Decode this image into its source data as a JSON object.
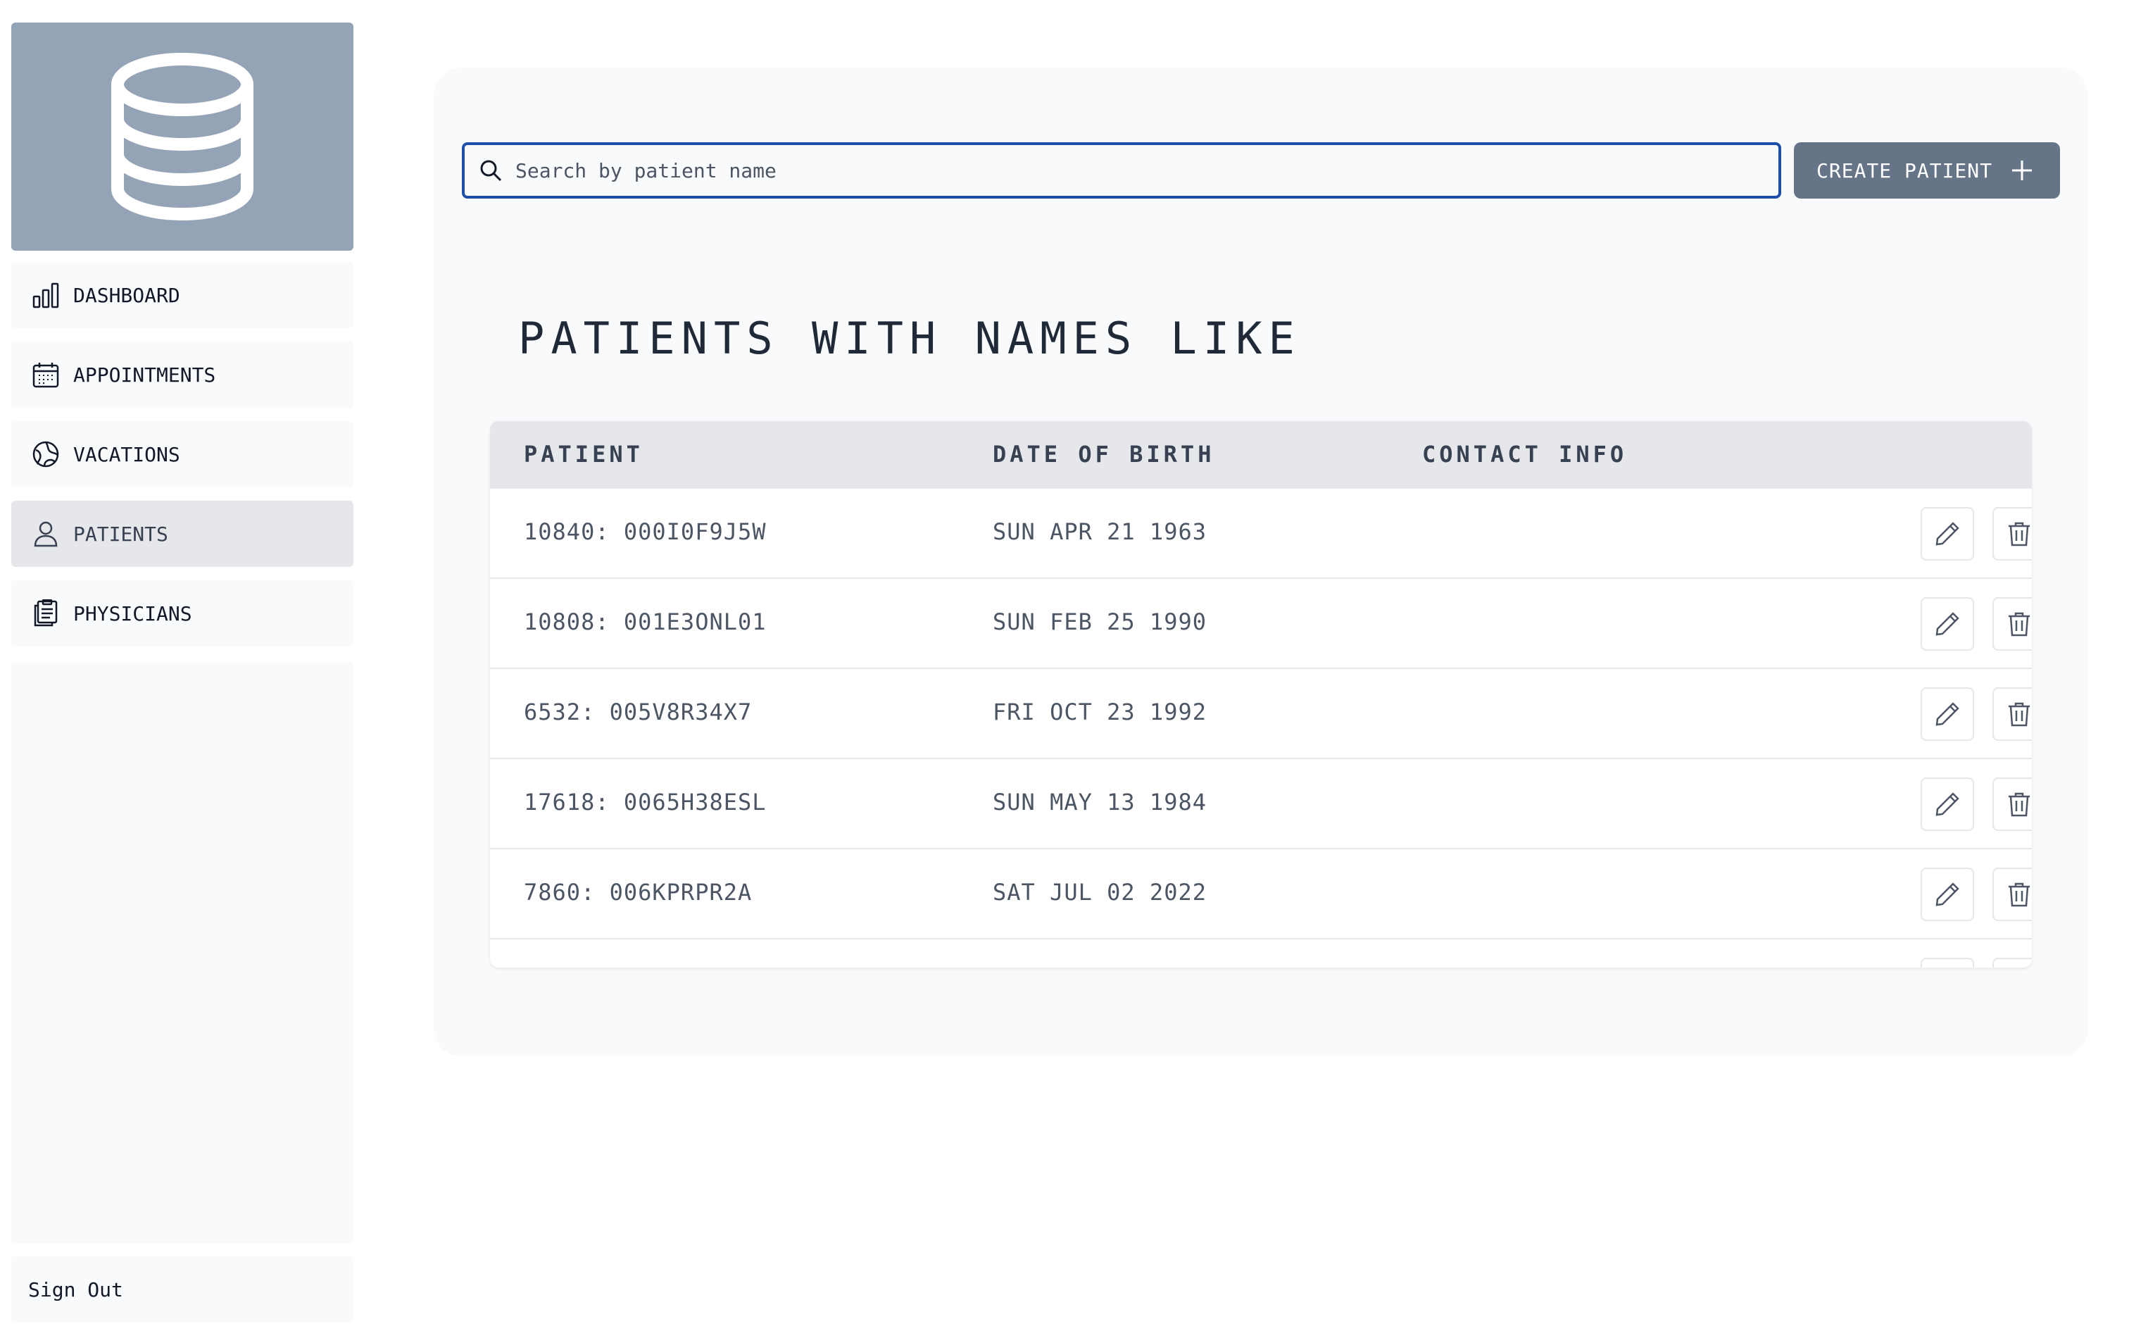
{
  "sidebar": {
    "logo_icon": "database-icon",
    "items": [
      {
        "label": "DASHBOARD",
        "icon": "bar-chart-icon"
      },
      {
        "label": "APPOINTMENTS",
        "icon": "calendar-icon"
      },
      {
        "label": "VACATIONS",
        "icon": "globe-icon"
      },
      {
        "label": "PATIENTS",
        "icon": "user-icon",
        "active": true
      },
      {
        "label": "PHYSICIANS",
        "icon": "clipboard-icon"
      }
    ],
    "sign_out": "Sign Out"
  },
  "search": {
    "placeholder": "Search by patient name",
    "value": "",
    "icon": "search-icon"
  },
  "create_button": {
    "label": "CREATE PATIENT",
    "icon": "plus-icon"
  },
  "heading": "PATIENTS WITH NAMES LIKE",
  "table": {
    "columns": [
      "PATIENT",
      "DATE OF BIRTH",
      "CONTACT INFO"
    ],
    "rows": [
      {
        "patient": "10840: 000I0F9J5W",
        "dob": "SUN APR 21 1963",
        "contact": ""
      },
      {
        "patient": "10808: 001E3ONL01",
        "dob": "SUN FEB 25 1990",
        "contact": ""
      },
      {
        "patient": "6532: 005V8R34X7",
        "dob": "FRI OCT 23 1992",
        "contact": ""
      },
      {
        "patient": "17618: 0065H38ESL",
        "dob": "SUN MAY 13 1984",
        "contact": ""
      },
      {
        "patient": "7860: 006KPRPR2A",
        "dob": "SAT JUL 02 2022",
        "contact": ""
      }
    ],
    "row_actions": [
      "pencil-icon",
      "trash-icon"
    ]
  },
  "colors": {
    "logo_bg": "#95a3b7",
    "accent_button": "#667488",
    "search_border": "#1e4fa8",
    "active_nav": "#e5e7eb",
    "panel_bg": "#f9fafb"
  }
}
